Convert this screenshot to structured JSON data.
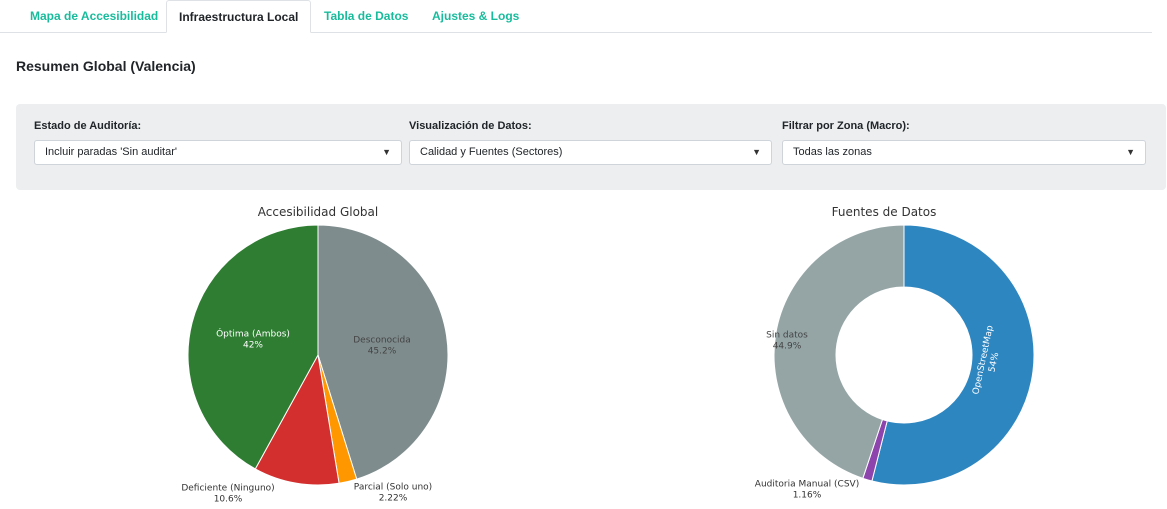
{
  "tabs": [
    {
      "label": "Mapa de Accesibilidad",
      "active": false
    },
    {
      "label": "Infraestructura Local",
      "active": true
    },
    {
      "label": "Tabla de Datos",
      "active": false
    },
    {
      "label": "Ajustes & Logs",
      "active": false
    }
  ],
  "page_title": "Resumen Global (Valencia)",
  "filters": [
    {
      "label": "Estado de Auditoría:",
      "value": "Incluir paradas 'Sin auditar'"
    },
    {
      "label": "Visualización de Datos:",
      "value": "Calidad y Fuentes (Sectores)"
    },
    {
      "label": "Filtrar por Zona (Macro):",
      "value": "Todas las zonas"
    }
  ],
  "colors": {
    "accent": "#18bc9c",
    "optima": "#2e7d32",
    "deficiente": "#d32f2f",
    "parcial": "#ff9800",
    "desconocida": "#7f8c8d",
    "openstreetmap": "#2e86c1",
    "auditoria_manual": "#8e44ad",
    "sin_datos": "#95a5a6"
  },
  "chart_data": [
    {
      "type": "pie",
      "title": "Accesibilidad Global",
      "slices": [
        {
          "label": "Desconocida",
          "value": 45.2,
          "value_text": "45.2%",
          "color": "#7f8c8d"
        },
        {
          "label": "Parcial (Solo uno)",
          "value": 2.22,
          "value_text": "2.22%",
          "color": "#ff9800"
        },
        {
          "label": "Deficiente (Ninguno)",
          "value": 10.6,
          "value_text": "10.6%",
          "color": "#d32f2f"
        },
        {
          "label": "Óptima (Ambos)",
          "value": 42,
          "value_text": "42%",
          "color": "#2e7d32"
        }
      ]
    },
    {
      "type": "pie",
      "donut": true,
      "title": "Fuentes de Datos",
      "slices": [
        {
          "label": "OpenStreetMap",
          "value": 54,
          "value_text": "54%",
          "color": "#2e86c1"
        },
        {
          "label": "Auditoria Manual (CSV)",
          "value": 1.16,
          "value_text": "1.16%",
          "color": "#8e44ad"
        },
        {
          "label": "Sin datos",
          "value": 44.9,
          "value_text": "44.9%",
          "color": "#95a5a6"
        }
      ]
    }
  ]
}
